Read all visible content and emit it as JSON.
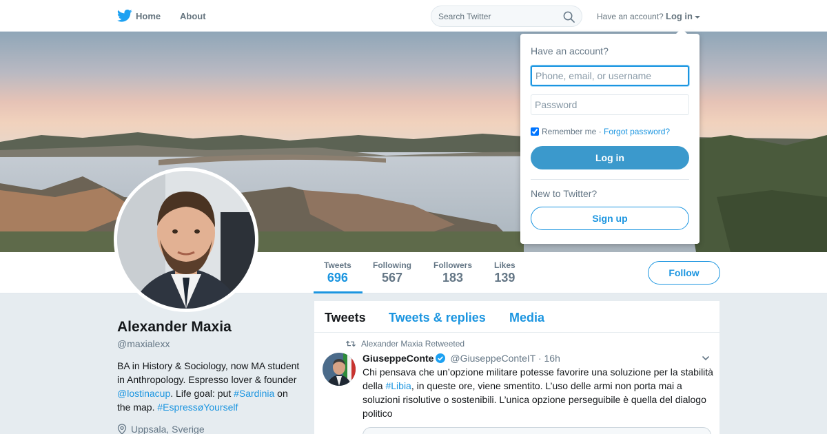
{
  "nav": {
    "logo_icon": "twitter-bird-icon",
    "home_label": "Home",
    "about_label": "About",
    "search_placeholder": "Search Twitter",
    "have_account_text": "Have an account?",
    "login_label": "Log in"
  },
  "dropdown": {
    "title": "Have an account?",
    "username_placeholder": "Phone, email, or username",
    "password_placeholder": "Password",
    "remember_label": "Remember me",
    "separator": "·",
    "forgot_label": "Forgot password?",
    "login_button": "Log in",
    "new_text": "New to Twitter?",
    "signup_button": "Sign up"
  },
  "stats": [
    {
      "label": "Tweets",
      "value": "696",
      "active": true
    },
    {
      "label": "Following",
      "value": "567",
      "active": false
    },
    {
      "label": "Followers",
      "value": "183",
      "active": false
    },
    {
      "label": "Likes",
      "value": "139",
      "active": false
    }
  ],
  "follow_label": "Follow",
  "profile": {
    "name": "Alexander Maxia",
    "handle": "@maxialexx",
    "bio_1": "BA in History & Sociology, now MA student in Anthropology. Espresso lover & founder ",
    "bio_link_1": "@lostinacup",
    "bio_2": ". Life goal: put ",
    "bio_link_2": "#Sardinia",
    "bio_3": " on the map. ",
    "bio_link_3": "#EspressøYourself",
    "location": "Uppsala, Sverige"
  },
  "timeline": {
    "tabs": [
      "Tweets",
      "Tweets & replies",
      "Media"
    ],
    "tweet": {
      "retweet_line": "Alexander Maxia Retweeted",
      "author": "GiuseppeConte",
      "handle": "@GiuseppeConteIT",
      "separator": "·",
      "time": "16h",
      "text_1": "Chi pensava che un’opzione militare potesse favorire una soluzione per la stabilità della ",
      "text_link": "#Libia",
      "text_2": ", in queste ore, viene smentito. L’uso delle armi non porta mai a soluzioni risolutive o sostenibili. L’unica opzione perseguibile è quella del dialogo politico"
    }
  },
  "colors": {
    "accent": "#1b95e0",
    "login_button": "#3b99cc",
    "background": "#e6ecf0"
  }
}
